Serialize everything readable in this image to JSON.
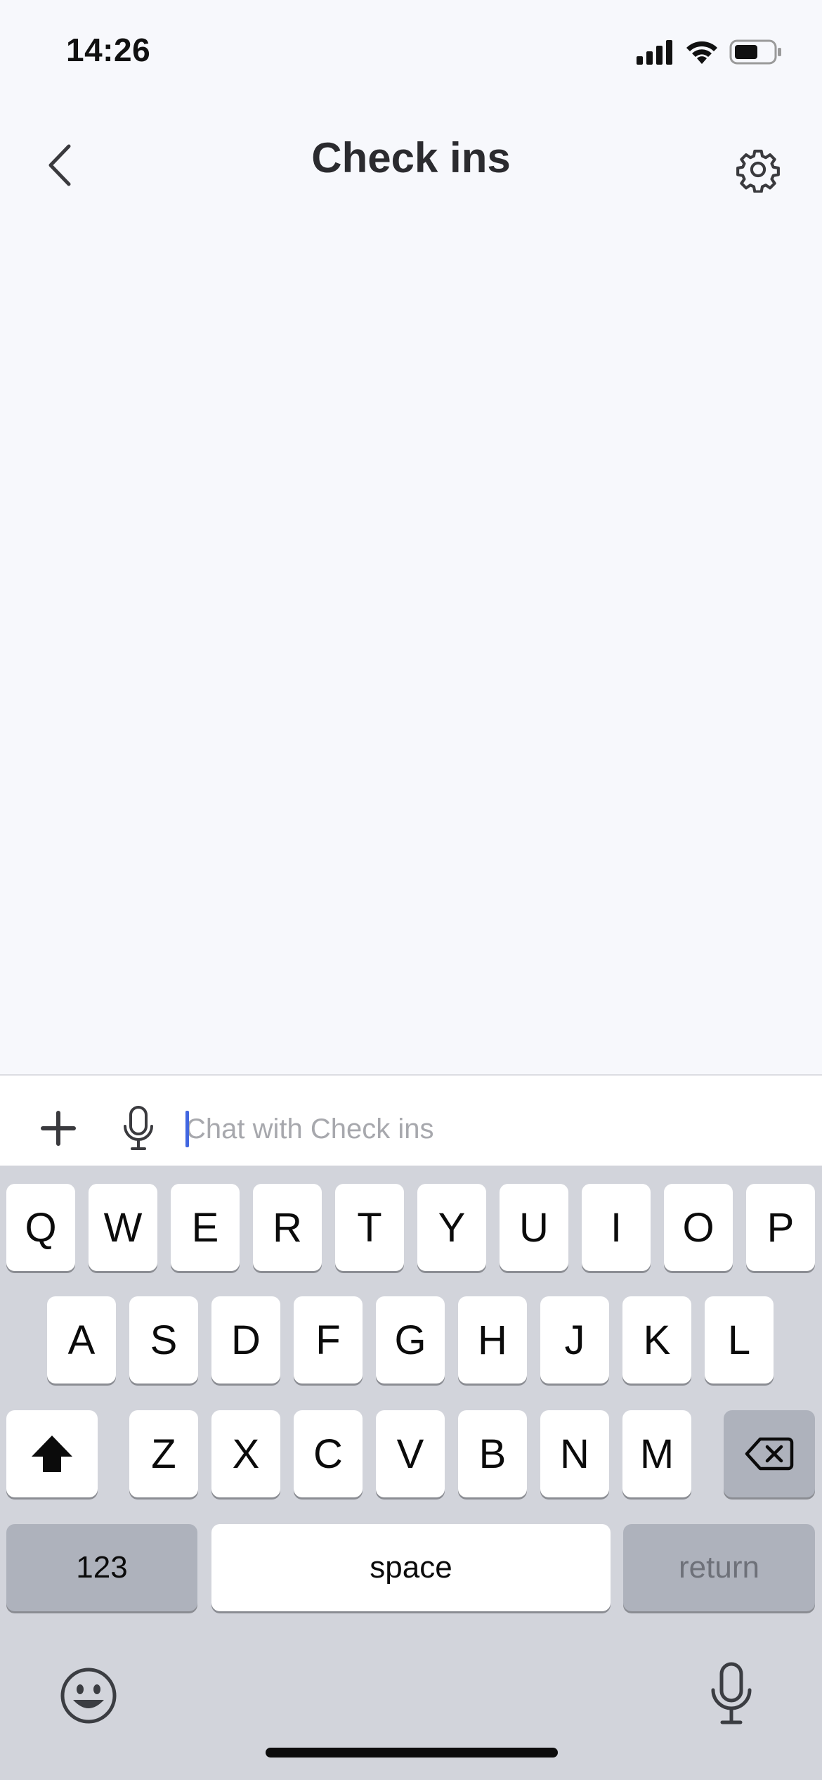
{
  "status_bar": {
    "time": "14:26"
  },
  "nav": {
    "title": "Check ins"
  },
  "composer": {
    "placeholder": "Chat with Check ins",
    "value": ""
  },
  "keyboard": {
    "row1": [
      "Q",
      "W",
      "E",
      "R",
      "T",
      "Y",
      "U",
      "I",
      "O",
      "P"
    ],
    "row2": [
      "A",
      "S",
      "D",
      "F",
      "G",
      "H",
      "J",
      "K",
      "L"
    ],
    "row3": [
      "Z",
      "X",
      "C",
      "V",
      "B",
      "N",
      "M"
    ],
    "numbers_label": "123",
    "space_label": "space",
    "return_label": "return"
  },
  "colors": {
    "background": "#f7f8fc",
    "keyboard_bg": "#d2d4db",
    "cursor": "#4166e0",
    "title": "#2b2b2f"
  }
}
